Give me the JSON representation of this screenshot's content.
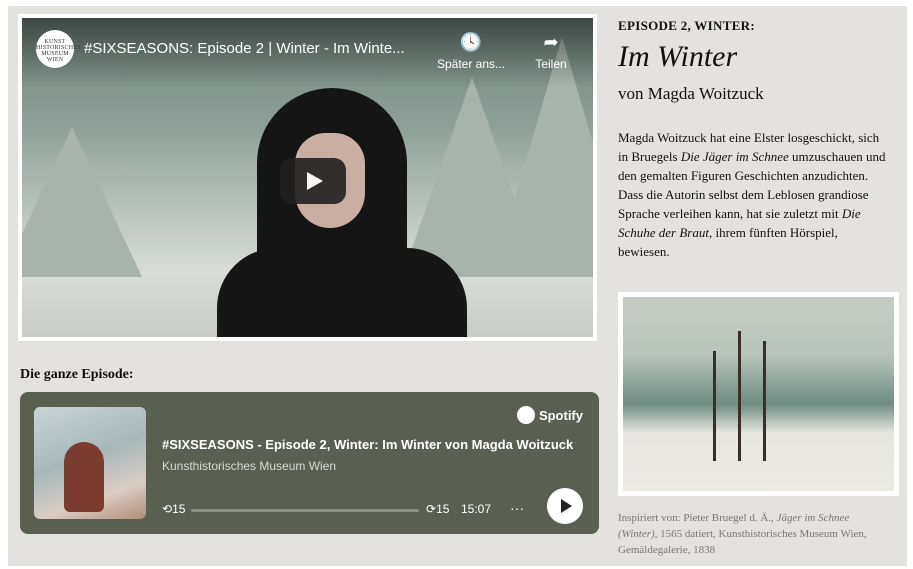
{
  "video": {
    "title": "#SIXSEASONS: Episode 2 | Winter - Im Winte...",
    "logo_text": "KUNST HISTORISCHES MUSEUM WIEN",
    "watch_later_label": "Später ans...",
    "share_label": "Teilen"
  },
  "episode_label": "Die ganze Episode:",
  "spotify": {
    "brand": "Spotify",
    "title": "#SIXSEASONS - Episode 2, Winter: Im Winter von Magda Woitzuck",
    "subtitle": "Kunsthistorisches Museum Wien",
    "skip_back": "15",
    "skip_forward": "15",
    "time": "15:07",
    "more": "···"
  },
  "article": {
    "kicker": "EPISODE 2, WINTER:",
    "title": "Im Winter",
    "byline": "von Magda Woitzuck",
    "p1": "Magda Woitzuck hat eine Elster losgeschickt, sich in Bruegels ",
    "p1_em": "Die Jäger im Schnee",
    "p2": " umzuschauen und den gemalten Figuren Geschichten anzudichten. Dass die Autorin selbst dem Leblosen grandiose Sprache verleihen kann, hat sie zuletzt mit ",
    "p2_em": "Die Schuhe der Braut",
    "p3": ", ihrem fünften Hörspiel, bewiesen."
  },
  "caption": {
    "pre": "Inspiriert von: Pieter Bruegel d. Ä., ",
    "em": "Jäger im Schnee (Winter)",
    "post": ", 1565 datiert, Kunsthistorisches Museum Wien, Gemäldegalerie, 1838"
  }
}
